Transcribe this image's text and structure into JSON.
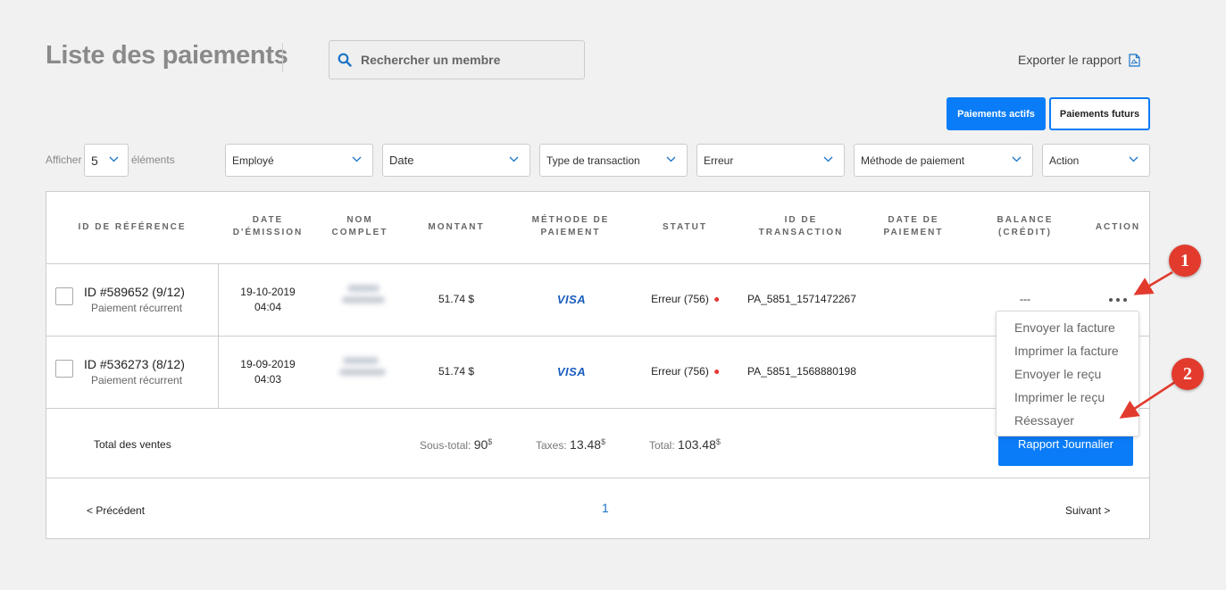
{
  "header": {
    "title": "Liste des paiements",
    "search_placeholder": "Rechercher un membre",
    "export_label": "Exporter le rapport"
  },
  "tabs": {
    "active": "Paiements actifs",
    "future": "Paiements futurs"
  },
  "show": {
    "before": "Afficher",
    "value": "5",
    "after": "éléments"
  },
  "filters": [
    "Employé",
    "Date",
    "Type de transaction",
    "Erreur",
    "Méthode de paiement",
    "Action"
  ],
  "columns": {
    "ref": "ID DE RÉFÉRENCE",
    "emission_1": "DATE",
    "emission_2": "D'ÉMISSION",
    "name_1": "NOM",
    "name_2": "COMPLET",
    "amount": "MONTANT",
    "method_1": "MÉTHODE DE",
    "method_2": "PAIEMENT",
    "status": "STATUT",
    "txid_1": "ID DE",
    "txid_2": "TRANSACTION",
    "paydate_1": "DATE DE",
    "paydate_2": "PAIEMENT",
    "balance_1": "BALANCE",
    "balance_2": "(CRÉDIT)",
    "action": "ACTION"
  },
  "rows": [
    {
      "ref": "ID #589652 (9/12)",
      "ref_sub": "Paiement récurrent",
      "date": "19-10-2019",
      "time": "04:04",
      "amount": "51.74 $",
      "method": "VISA",
      "status": "Erreur (756)",
      "txid": "PA_5851_1571472267",
      "balance": "---"
    },
    {
      "ref": "ID #536273 (8/12)",
      "ref_sub": "Paiement récurrent",
      "date": "19-09-2019",
      "time": "04:03",
      "amount": "51.74 $",
      "method": "VISA",
      "status": "Erreur (756)",
      "txid": "PA_5851_1568880198",
      "balance": ""
    }
  ],
  "action_menu": [
    "Envoyer la facture",
    "Imprimer la facture",
    "Envoyer le reçu",
    "Imprimer le reçu",
    "Réessayer"
  ],
  "totals": {
    "label": "Total des ventes",
    "subtotal_label": "Sous-total:",
    "subtotal_value": "90",
    "taxes_label": "Taxes:",
    "taxes_value": "13.48",
    "total_label": "Total:",
    "total_value": "103.48",
    "currency": "$",
    "daily_report": "Rapport Journalier"
  },
  "pagination": {
    "prev": "< Précédent",
    "page": "1",
    "next": "Suivant >"
  },
  "annotations": [
    "1",
    "2"
  ],
  "colors": {
    "accent": "#0a7cf7",
    "annotation": "#e23b2e",
    "status_dot": "#e53935"
  }
}
